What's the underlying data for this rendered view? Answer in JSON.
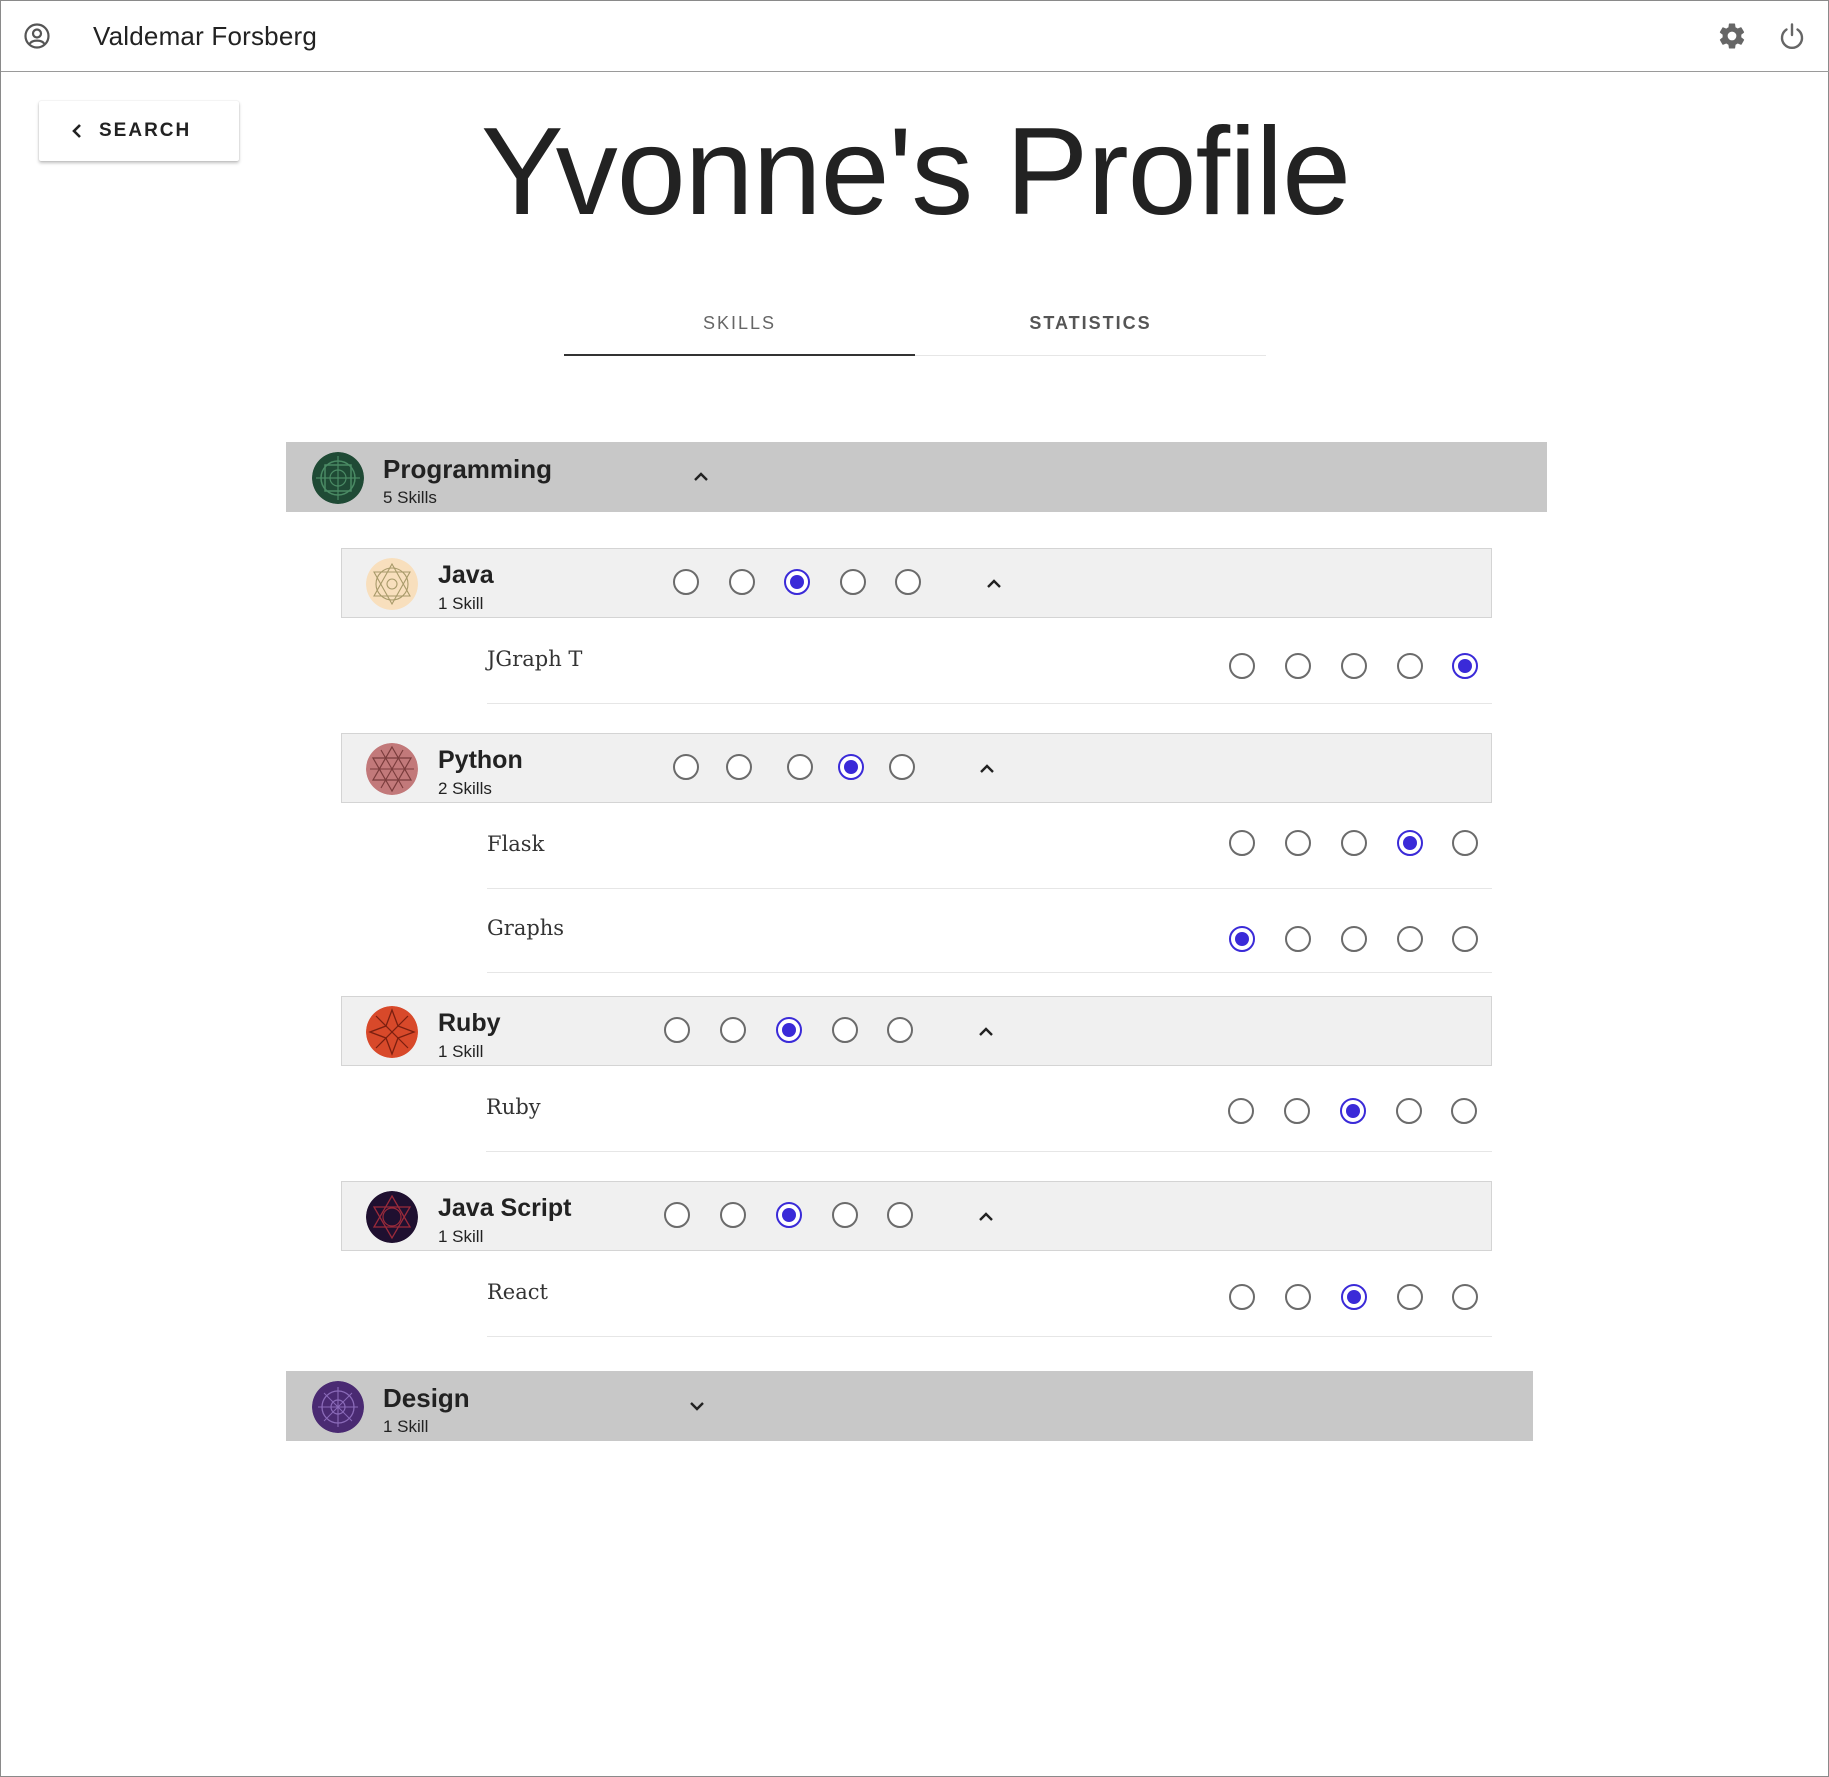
{
  "header": {
    "user_name": "Valdemar Forsberg"
  },
  "nav": {
    "back_label": "SEARCH"
  },
  "page": {
    "title": "Yvonne's Profile"
  },
  "tabs": [
    {
      "label": "SKILLS",
      "active": true
    },
    {
      "label": "STATISTICS",
      "active": false
    }
  ],
  "colors": {
    "accent": "#3a2ad8",
    "category_bg": "#c8c8c8",
    "group_bg": "#f0f0f0"
  },
  "categories": [
    {
      "name": "Programming",
      "count": "5 Skills",
      "expanded": true,
      "groups": [
        {
          "name": "Java",
          "count": "1 Skill",
          "rating": 3,
          "skills": [
            {
              "name": "JGraph T",
              "rating": 5
            }
          ]
        },
        {
          "name": "Python",
          "count": "2 Skills",
          "rating": 4,
          "skills": [
            {
              "name": "Flask",
              "rating": 4
            },
            {
              "name": "Graphs",
              "rating": 1
            }
          ]
        },
        {
          "name": "Ruby",
          "count": "1 Skill",
          "rating": 3,
          "skills": [
            {
              "name": "Ruby",
              "rating": 3
            }
          ]
        },
        {
          "name": "Java Script",
          "count": "1 Skill",
          "rating": 3,
          "skills": [
            {
              "name": "React",
              "rating": 3
            }
          ]
        }
      ]
    },
    {
      "name": "Design",
      "count": "1 Skill",
      "expanded": false,
      "groups": []
    }
  ]
}
